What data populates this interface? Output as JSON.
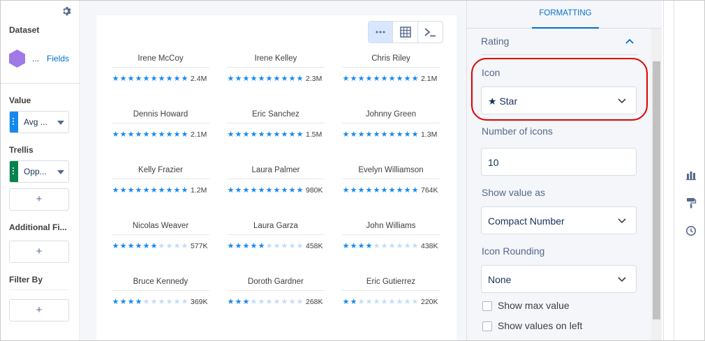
{
  "left_panel": {
    "dataset_label": "Dataset",
    "dataset_ellipsis": "...",
    "fields_link": "Fields",
    "value_label": "Value",
    "value_pill": "Avg ...",
    "trellis_label": "Trellis",
    "trellis_pill": "Opp...",
    "add_symbol": "+",
    "additional_fields_label": "Additional Fi...",
    "filter_by_label": "Filter By",
    "colors": {
      "value_bar": "#1589ee",
      "trellis_bar": "#04844b",
      "dataset_hex": "#9f79e8"
    }
  },
  "toolbar": {
    "buttons": [
      {
        "icon": "ellipsis-icon",
        "active": true
      },
      {
        "icon": "table-icon",
        "active": false
      },
      {
        "icon": "terminal-icon",
        "active": false
      }
    ]
  },
  "chart_data": {
    "type": "rating",
    "icon": "star",
    "number_of_icons": 10,
    "filled_color": "#1589ee",
    "empty_color": "#c5dcf5",
    "items": [
      {
        "name": "Irene McCoy",
        "rating": 10,
        "value": "2.4M"
      },
      {
        "name": "Irene Kelley",
        "rating": 10,
        "value": "2.3M"
      },
      {
        "name": "Chris Riley",
        "rating": 10,
        "value": "2.1M"
      },
      {
        "name": "Dennis Howard",
        "rating": 10,
        "value": "2.1M"
      },
      {
        "name": "Eric Sanchez",
        "rating": 10,
        "value": "1.5M"
      },
      {
        "name": "Johnny Green",
        "rating": 10,
        "value": "1.3M"
      },
      {
        "name": "Kelly Frazier",
        "rating": 10,
        "value": "1.2M"
      },
      {
        "name": "Laura Palmer",
        "rating": 10,
        "value": "980K"
      },
      {
        "name": "Evelyn Williamson",
        "rating": 10,
        "value": "764K"
      },
      {
        "name": "Nicolas Weaver",
        "rating": 6,
        "value": "577K"
      },
      {
        "name": "Laura Garza",
        "rating": 5,
        "value": "458K"
      },
      {
        "name": "John Williams",
        "rating": 4,
        "value": "438K"
      },
      {
        "name": "Bruce Kennedy",
        "rating": 4,
        "value": "369K"
      },
      {
        "name": "Doroth Gardner",
        "rating": 3,
        "value": "268K"
      },
      {
        "name": "Eric Gutierrez",
        "rating": 2,
        "value": "220K"
      }
    ]
  },
  "right_panel": {
    "tab": "FORMATTING",
    "section_title": "Rating",
    "icon_label": "Icon",
    "icon_value": "★ Star",
    "number_of_icons_label": "Number of icons",
    "number_of_icons_value": "10",
    "show_value_as_label": "Show value as",
    "show_value_as_value": "Compact Number",
    "icon_rounding_label": "Icon Rounding",
    "icon_rounding_value": "None",
    "show_max_value_label": "Show max value",
    "show_values_on_left_label": "Show values on left",
    "highlight_color": "#e00000"
  },
  "rail": {
    "icons": [
      "bar-chart-icon",
      "paint-roller-icon",
      "clock-icon"
    ]
  }
}
